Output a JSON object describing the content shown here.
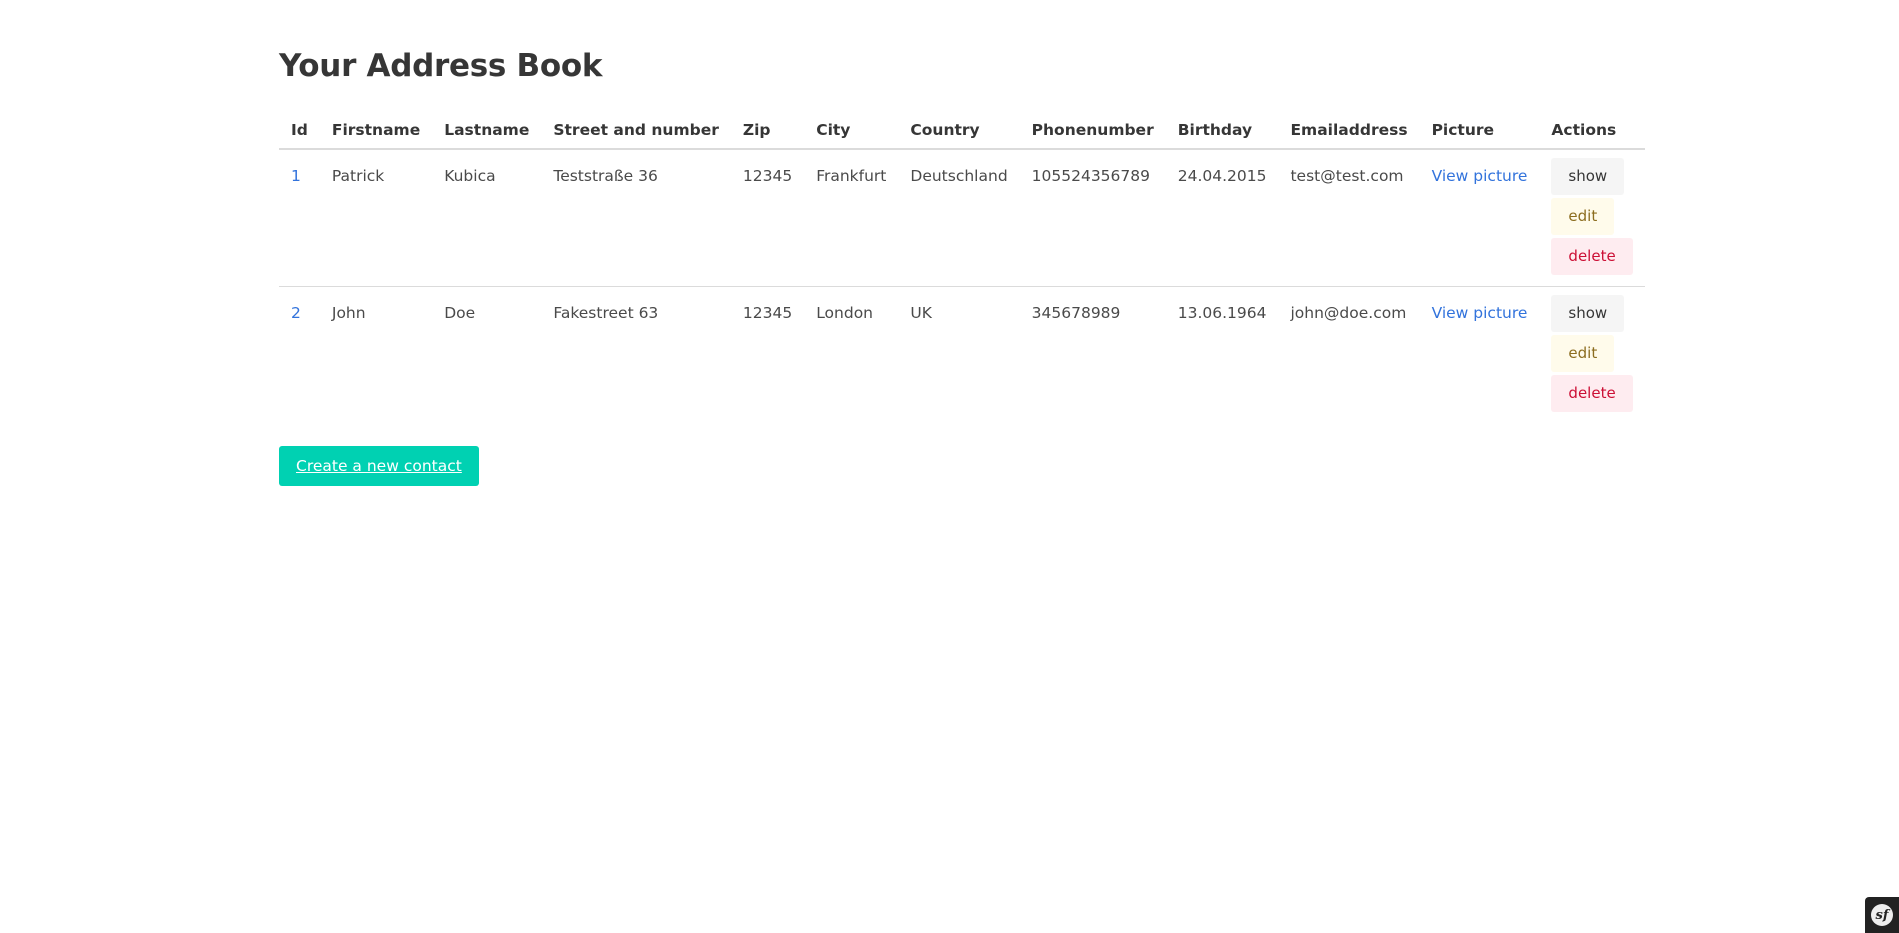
{
  "page": {
    "title": "Your Address Book",
    "create_button": "Create a new contact"
  },
  "table": {
    "headers": [
      "Id",
      "Firstname",
      "Lastname",
      "Street and number",
      "Zip",
      "City",
      "Country",
      "Phonenumber",
      "Birthday",
      "Emailaddress",
      "Picture",
      "Actions"
    ],
    "rows": [
      {
        "id": "1",
        "firstname": "Patrick",
        "lastname": "Kubica",
        "street": "Teststraße 36",
        "zip": "12345",
        "city": "Frankfurt",
        "country": "Deutschland",
        "phone": "105524356789",
        "birthday": "24.04.2015",
        "email": "test@test.com",
        "picture": "View picture"
      },
      {
        "id": "2",
        "firstname": "John",
        "lastname": "Doe",
        "street": "Fakestreet 63",
        "zip": "12345",
        "city": "London",
        "country": "UK",
        "phone": "345678989",
        "birthday": "13.06.1964",
        "email": "john@doe.com",
        "picture": "View picture"
      }
    ],
    "actions": {
      "show": "show",
      "edit": "edit",
      "delete": "delete"
    }
  },
  "toolbar": {
    "logo_text": "sf",
    "icon": "symfony-logo-icon"
  },
  "colors": {
    "link": "#3273dc",
    "primary": "#00d1b2",
    "warning_bg": "#fffbeb",
    "danger_bg": "#feecf0"
  }
}
